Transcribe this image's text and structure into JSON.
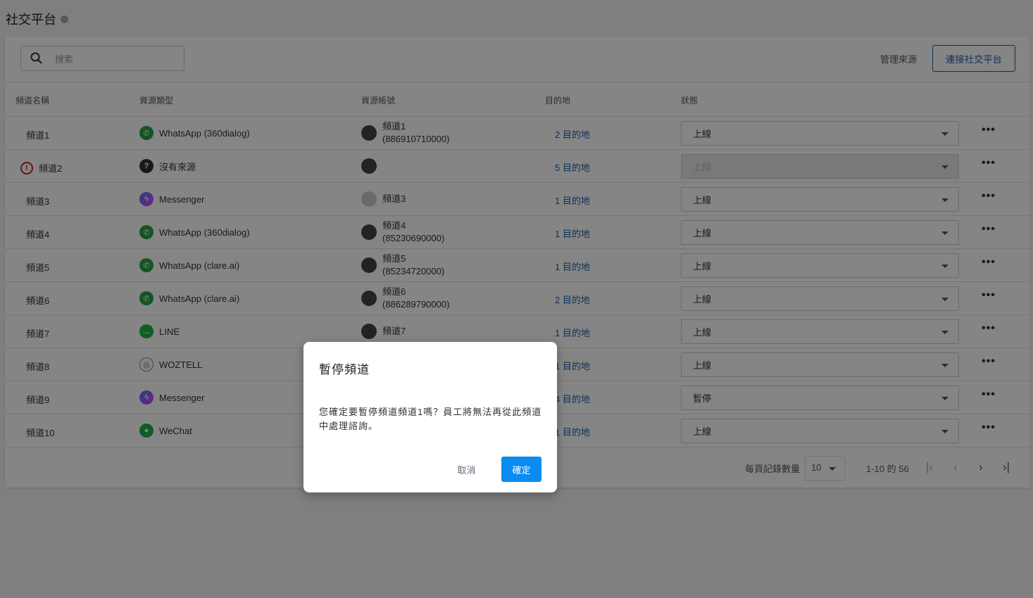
{
  "page": {
    "title": "社交平台"
  },
  "toolbar": {
    "search_placeholder": "搜索",
    "manage": "管理來源",
    "connect": "連接社交平台"
  },
  "columns": [
    "頻道名稱",
    "資源類型",
    "資源帳號",
    "目的地",
    "狀態"
  ],
  "rows": [
    {
      "name": "頻道1",
      "type": "WhatsApp (360dialog)",
      "acc1": "頻道1",
      "acc2": "(886910710000)",
      "dest": "2 目的地",
      "status": "上線"
    },
    {
      "name": "頻道2",
      "type": "沒有來源",
      "acc1": "",
      "acc2": "",
      "dest": "5 目的地",
      "status": "上線"
    },
    {
      "name": "頻道3",
      "type": "Messenger",
      "acc1": "頻道3",
      "acc2": "",
      "dest": "1 目的地",
      "status": "上線"
    },
    {
      "name": "頻道4",
      "type": "WhatsApp (360dialog)",
      "acc1": "頻道4",
      "acc2": "(85230690000)",
      "dest": "1 目的地",
      "status": "上線"
    },
    {
      "name": "頻道5",
      "type": "WhatsApp (clare.ai)",
      "acc1": "頻道5",
      "acc2": "(85234720000)",
      "dest": "1 目的地",
      "status": "上線"
    },
    {
      "name": "頻道6",
      "type": "WhatsApp (clare.ai)",
      "acc1": "頻道6",
      "acc2": "(886289790000)",
      "dest": "2 目的地",
      "status": "上線"
    },
    {
      "name": "頻道7",
      "type": "LINE",
      "acc1": "頻道7",
      "acc2": "",
      "dest": "1 目的地",
      "status": "上線"
    },
    {
      "name": "頻道8",
      "type": "WOZTELL",
      "acc1": "",
      "acc2": "",
      "dest": "1 目的地",
      "status": "上線"
    },
    {
      "name": "頻道9",
      "type": "Messenger",
      "acc1": "",
      "acc2": "",
      "dest": "4 目的地",
      "status": "暫停"
    },
    {
      "name": "頻道10",
      "type": "WeChat",
      "acc1": "",
      "acc2": "",
      "dest": "1 目的地",
      "status": "上線"
    }
  ],
  "pagination": {
    "per_page_label": "每頁記錄數量",
    "per_page": "10",
    "range": "1-10 的 56"
  },
  "dialog": {
    "title": "暫停頻道",
    "message": "您確定要暫停頻道頻道1嗎？員工將無法再從此頻道中處理諮詢。",
    "cancel": "取消",
    "confirm": "確定"
  }
}
